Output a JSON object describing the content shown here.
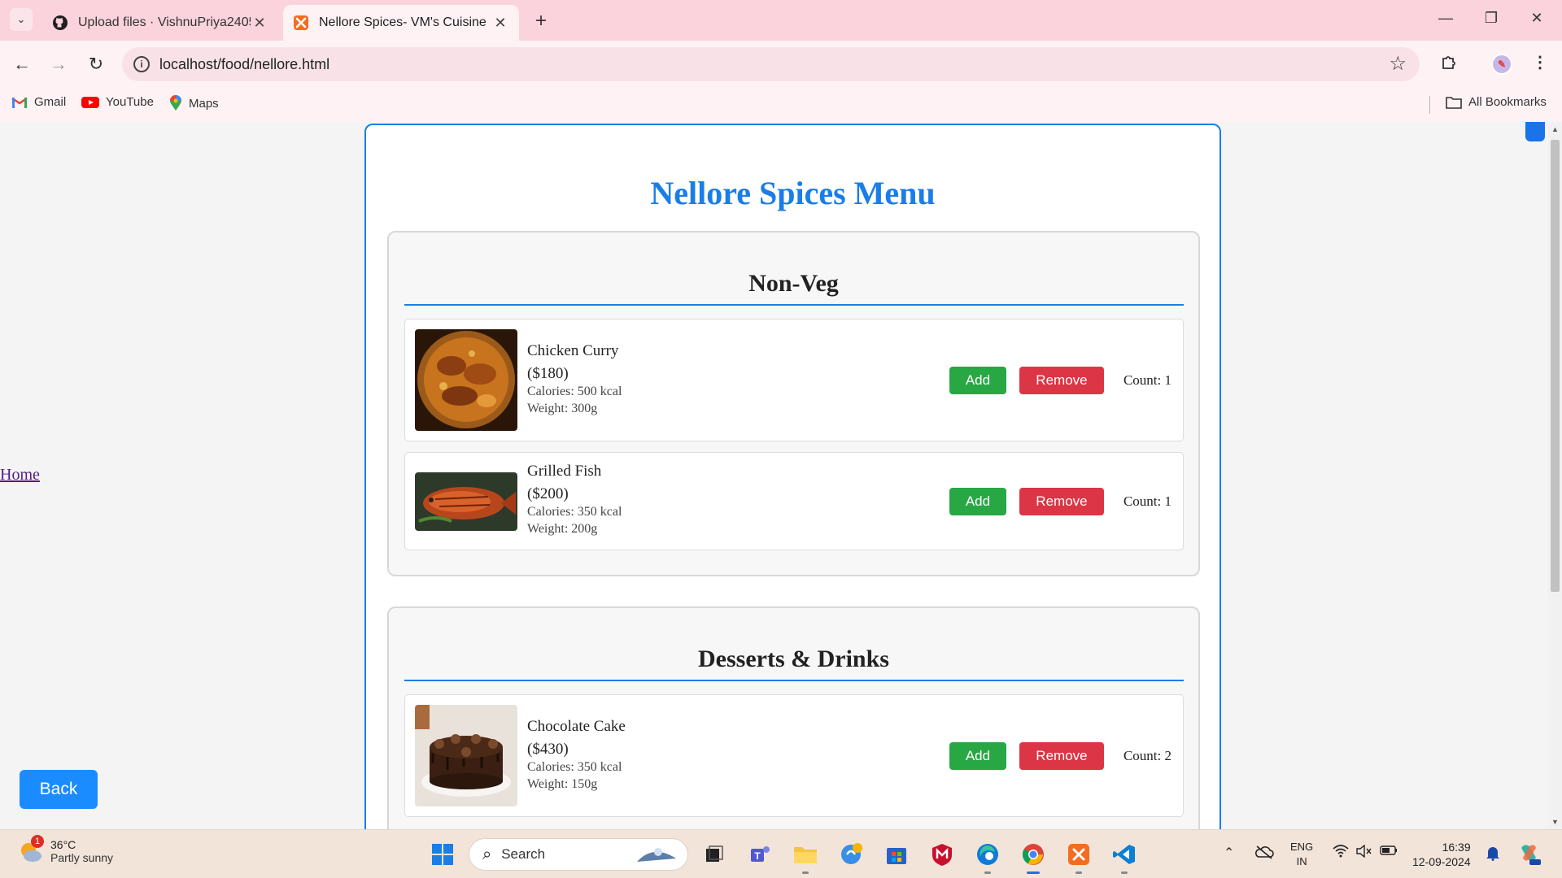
{
  "browser": {
    "tabs": [
      {
        "title": "Upload files · VishnuPriya2405/",
        "active": false,
        "favicon": "github-icon"
      },
      {
        "title": "Nellore Spices- VM's Cuisine",
        "active": true,
        "favicon": "xampp-icon"
      }
    ],
    "url": "localhost/food/nellore.html",
    "bookmarks": [
      {
        "label": "Gmail",
        "icon": "gmail-icon"
      },
      {
        "label": "YouTube",
        "icon": "youtube-icon"
      },
      {
        "label": "Maps",
        "icon": "maps-icon"
      }
    ],
    "all_bookmarks": "All Bookmarks"
  },
  "page": {
    "home_link": "Home",
    "back_button": "Back",
    "menu_title": "Nellore Spices Menu",
    "sections": [
      {
        "title": "Non-Veg",
        "items": [
          {
            "name": "Chicken Curry",
            "price": "($180)",
            "calories": "Calories: 500 kcal",
            "weight": "Weight: 300g",
            "add": "Add",
            "remove": "Remove",
            "count": "Count: 1"
          },
          {
            "name": "Grilled Fish",
            "price": "($200)",
            "calories": "Calories: 350 kcal",
            "weight": "Weight: 200g",
            "add": "Add",
            "remove": "Remove",
            "count": "Count: 1"
          }
        ]
      },
      {
        "title": "Desserts & Drinks",
        "items": [
          {
            "name": "Chocolate Cake",
            "price": "($430)",
            "calories": "Calories: 350 kcal",
            "weight": "Weight: 150g",
            "add": "Add",
            "remove": "Remove",
            "count": "Count: 2"
          }
        ]
      }
    ]
  },
  "taskbar": {
    "weather_temp": "36°C",
    "weather_condition": "Partly sunny",
    "weather_badge": "1",
    "search_label": "Search",
    "language_line1": "ENG",
    "language_line2": "IN",
    "time": "16:39",
    "date": "12-09-2024"
  },
  "colors": {
    "accent": "#1a7de8",
    "add_button": "#28a745",
    "remove_button": "#dc3545",
    "back_button": "#1a8cff",
    "tab_strip": "#fbd3dd"
  }
}
